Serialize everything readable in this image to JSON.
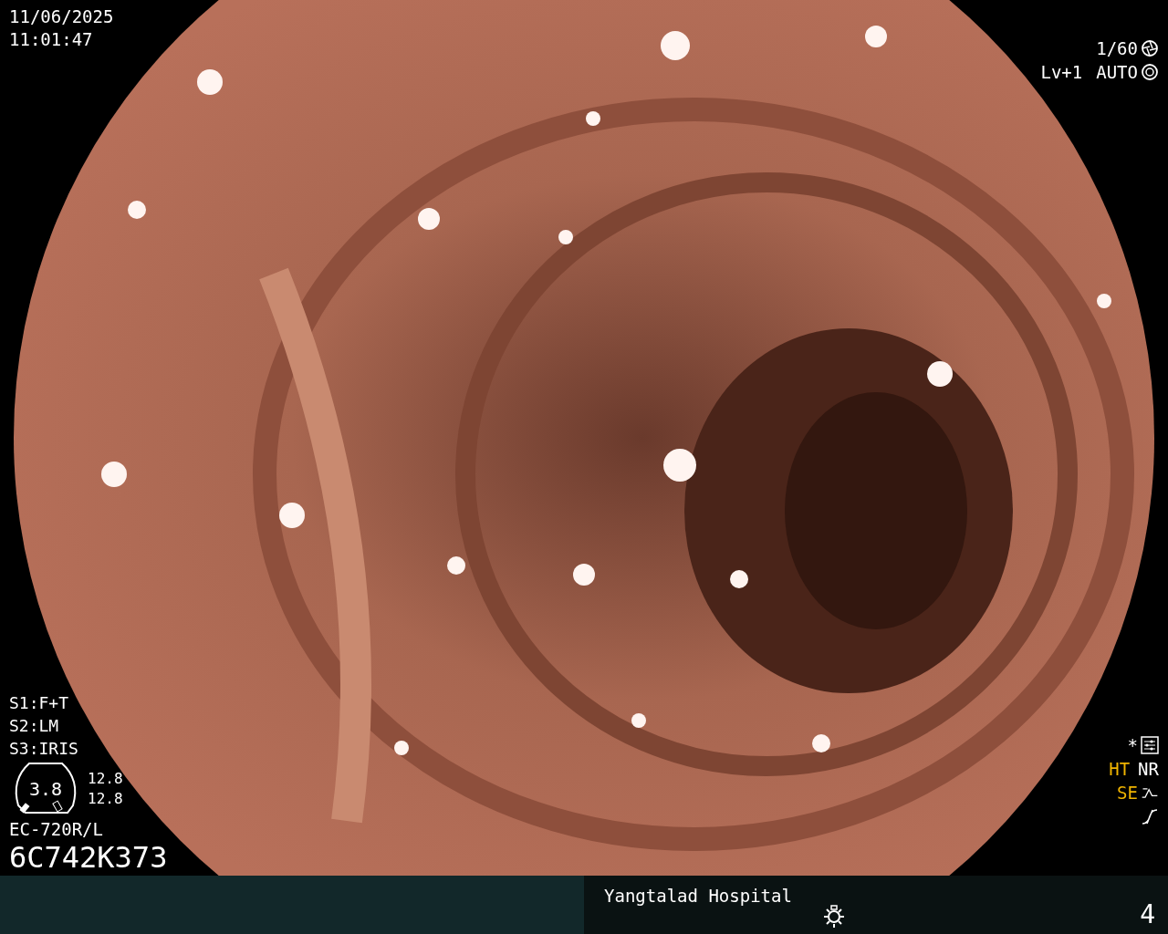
{
  "datetime": {
    "date": "11/06/2025",
    "time": "11:01:47"
  },
  "exposure": {
    "shutter": "1/60",
    "level": "Lv+1",
    "mode": "AUTO"
  },
  "switches": [
    "S1:F+T",
    "S2:LM",
    "S3:IRIS"
  ],
  "gauge": {
    "value": "3.8",
    "readings": [
      "12.8",
      "12.8"
    ]
  },
  "scope": {
    "model": "EC-720R/L",
    "serial": "6C742K373"
  },
  "status_marks": [
    {
      "kind": "settings",
      "labels": [
        {
          "text": "*",
          "color": "#ffffff"
        }
      ]
    },
    {
      "kind": "plain",
      "labels": [
        {
          "text": "HT",
          "color": "#f0b400"
        },
        {
          "text": "NR",
          "color": "#ffffff"
        }
      ]
    },
    {
      "kind": "curve",
      "labels": [
        {
          "text": "SE",
          "color": "#f0b400"
        }
      ]
    },
    {
      "kind": "slash"
    }
  ],
  "footer": {
    "hospital": "Yangtalad Hospital",
    "page": "4"
  }
}
